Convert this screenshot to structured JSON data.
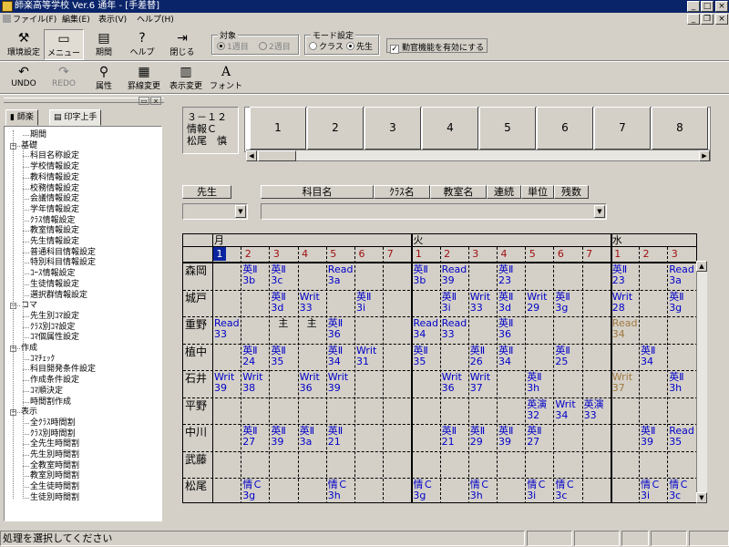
{
  "window": {
    "title": "師楽高等学校 Ver.6 通年 - [手差替]"
  },
  "menu": [
    {
      "label": "ファイル(F)"
    },
    {
      "label": "編集(E)"
    },
    {
      "label": "表示(V)"
    },
    {
      "label": "ヘルプ(H)"
    }
  ],
  "toolbar": {
    "row1": [
      {
        "label": "環境設定",
        "icon": "settings-icon"
      },
      {
        "label": "メニュー",
        "icon": "menu-icon"
      },
      {
        "label": "期間",
        "icon": "period-icon"
      },
      {
        "label": "ヘルプ",
        "icon": "help-icon"
      },
      {
        "label": "閉じる",
        "icon": "close-icon"
      }
    ],
    "row2": [
      {
        "label": "UNDO",
        "icon": "undo-icon"
      },
      {
        "label": "REDO",
        "icon": "redo-icon"
      },
      {
        "label": "属性",
        "icon": "attribute-icon"
      },
      {
        "label": "罫線変更",
        "icon": "grid-lines-icon"
      },
      {
        "label": "表示変更",
        "icon": "display-change-icon"
      },
      {
        "label": "フォント",
        "icon": "font-icon"
      }
    ]
  },
  "target_group": {
    "label": "対象",
    "options": [
      "1週目",
      "2週目"
    ]
  },
  "mode_group": {
    "label": "モード設定",
    "options": [
      "クラス",
      "先生"
    ]
  },
  "check_prohibit": {
    "label": "勤官機能を有効にする"
  },
  "tabs": [
    "師楽",
    "印字上手"
  ],
  "tree": [
    {
      "label": "期間",
      "level": 1
    },
    {
      "label": "基礎",
      "level": 0
    },
    {
      "label": "科目名称設定",
      "level": 1
    },
    {
      "label": "学校情報設定",
      "level": 1
    },
    {
      "label": "教科情報設定",
      "level": 1
    },
    {
      "label": "校務情報設定",
      "level": 1
    },
    {
      "label": "会議情報設定",
      "level": 1
    },
    {
      "label": "学年情報設定",
      "level": 1
    },
    {
      "label": "ｸﾗｽ情報設定",
      "level": 1
    },
    {
      "label": "教室情報設定",
      "level": 1
    },
    {
      "label": "先生情報設定",
      "level": 1
    },
    {
      "label": "普通科目情報設定",
      "level": 1
    },
    {
      "label": "特別科目情報設定",
      "level": 1
    },
    {
      "label": "ｺｰｽ情報設定",
      "level": 1
    },
    {
      "label": "生徒情報設定",
      "level": 1
    },
    {
      "label": "選択群情報設定",
      "level": 1
    },
    {
      "label": "コマ",
      "level": 0
    },
    {
      "label": "先生別ｺﾏ設定",
      "level": 1
    },
    {
      "label": "ｸﾗｽ別ｺﾏ設定",
      "level": 1
    },
    {
      "label": "ｺﾏ個属性設定",
      "level": 1
    },
    {
      "label": "作成",
      "level": 0
    },
    {
      "label": "ｺﾏﾁｪｯｸ",
      "level": 1
    },
    {
      "label": "科目開発条件設定",
      "level": 1
    },
    {
      "label": "作成条件設定",
      "level": 1
    },
    {
      "label": "ｺﾏ順決定",
      "level": 1
    },
    {
      "label": "時間割作成",
      "level": 1
    },
    {
      "label": "表示",
      "level": 0
    },
    {
      "label": "全ｸﾗｽ時間割",
      "level": 1
    },
    {
      "label": "ｸﾗｽ別時間割",
      "level": 1
    },
    {
      "label": "全先生時間割",
      "level": 1
    },
    {
      "label": "先生別時間割",
      "level": 1
    },
    {
      "label": "全教室時間割",
      "level": 1
    },
    {
      "label": "教室別時間割",
      "level": 1
    },
    {
      "label": "全生徒時間割",
      "level": 1
    },
    {
      "label": "生徒別時間割",
      "level": 1
    }
  ],
  "info": {
    "line1": "３－１２",
    "line2": "情報Ｃ",
    "line3": "松尾　慎"
  },
  "period_buttons": [
    "1",
    "2",
    "3",
    "4",
    "5",
    "6",
    "7",
    "8"
  ],
  "columns": [
    "先生",
    "科目名",
    "ｸﾗｽ名",
    "教室名",
    "連続",
    "単位",
    "残数"
  ],
  "grid": {
    "days": [
      "月",
      "火",
      "水"
    ],
    "periods": [
      "1",
      "2",
      "3",
      "4",
      "5",
      "6",
      "7",
      "1",
      "2",
      "3",
      "4",
      "5",
      "6",
      "7",
      "1",
      "2",
      "3"
    ],
    "teachers": [
      "森岡",
      "城戸",
      "重野",
      "植中",
      "石井",
      "平野",
      "中川",
      "武藤",
      "松尾"
    ]
  },
  "cells": [
    {
      "r": 0,
      "c": 1,
      "a": "英Ⅱ",
      "b": "3b"
    },
    {
      "r": 0,
      "c": 2,
      "a": "英Ⅱ",
      "b": "3c"
    },
    {
      "r": 0,
      "c": 4,
      "a": "Read",
      "b": "3a"
    },
    {
      "r": 0,
      "c": 7,
      "a": "英Ⅱ",
      "b": "3b"
    },
    {
      "r": 0,
      "c": 8,
      "a": "Read",
      "b": "39"
    },
    {
      "r": 0,
      "c": 10,
      "a": "英Ⅱ",
      "b": "23"
    },
    {
      "r": 0,
      "c": 14,
      "a": "英Ⅱ",
      "b": "23"
    },
    {
      "r": 0,
      "c": 16,
      "a": "Read",
      "b": "3a"
    },
    {
      "r": 1,
      "c": 2,
      "a": "英Ⅱ",
      "b": "3d"
    },
    {
      "r": 1,
      "c": 3,
      "a": "Writ",
      "b": "33"
    },
    {
      "r": 1,
      "c": 5,
      "a": "英Ⅱ",
      "b": "3i"
    },
    {
      "r": 1,
      "c": 8,
      "a": "英Ⅱ",
      "b": "3i"
    },
    {
      "r": 1,
      "c": 9,
      "a": "Writ",
      "b": "33"
    },
    {
      "r": 1,
      "c": 10,
      "a": "英Ⅱ",
      "b": "3d"
    },
    {
      "r": 1,
      "c": 11,
      "a": "Writ",
      "b": "29"
    },
    {
      "r": 1,
      "c": 12,
      "a": "英Ⅱ",
      "b": "3g"
    },
    {
      "r": 1,
      "c": 14,
      "a": "Writ",
      "b": "28"
    },
    {
      "r": 1,
      "c": 16,
      "a": "英Ⅱ",
      "b": "3g"
    },
    {
      "r": 2,
      "c": 0,
      "a": "Read",
      "b": "33"
    },
    {
      "r": 2,
      "c": 2,
      "a": "",
      "b": "主",
      "k": "blk"
    },
    {
      "r": 2,
      "c": 3,
      "a": "",
      "b": "主",
      "k": "blk"
    },
    {
      "r": 2,
      "c": 4,
      "a": "英Ⅱ",
      "b": "36"
    },
    {
      "r": 2,
      "c": 7,
      "a": "Read",
      "b": "34"
    },
    {
      "r": 2,
      "c": 8,
      "a": "Read",
      "b": "33"
    },
    {
      "r": 2,
      "c": 10,
      "a": "英Ⅱ",
      "b": "36"
    },
    {
      "r": 2,
      "c": 14,
      "a": "Read",
      "b": "34",
      "k": "brown"
    },
    {
      "r": 3,
      "c": 1,
      "a": "英Ⅱ",
      "b": "24"
    },
    {
      "r": 3,
      "c": 2,
      "a": "英Ⅱ",
      "b": "35"
    },
    {
      "r": 3,
      "c": 4,
      "a": "英Ⅱ",
      "b": "34"
    },
    {
      "r": 3,
      "c": 5,
      "a": "Writ",
      "b": "31"
    },
    {
      "r": 3,
      "c": 7,
      "a": "英Ⅱ",
      "b": "35"
    },
    {
      "r": 3,
      "c": 9,
      "a": "英Ⅱ",
      "b": "26"
    },
    {
      "r": 3,
      "c": 10,
      "a": "英Ⅱ",
      "b": "34"
    },
    {
      "r": 3,
      "c": 12,
      "a": "英Ⅱ",
      "b": "25"
    },
    {
      "r": 3,
      "c": 15,
      "a": "英Ⅱ",
      "b": "34"
    },
    {
      "r": 4,
      "c": 0,
      "a": "Writ",
      "b": "39"
    },
    {
      "r": 4,
      "c": 1,
      "a": "Writ",
      "b": "38"
    },
    {
      "r": 4,
      "c": 3,
      "a": "Writ",
      "b": "36"
    },
    {
      "r": 4,
      "c": 4,
      "a": "Writ",
      "b": "39"
    },
    {
      "r": 4,
      "c": 8,
      "a": "Writ",
      "b": "36"
    },
    {
      "r": 4,
      "c": 9,
      "a": "Writ",
      "b": "37"
    },
    {
      "r": 4,
      "c": 11,
      "a": "英Ⅱ",
      "b": "3h"
    },
    {
      "r": 4,
      "c": 14,
      "a": "Writ",
      "b": "37",
      "k": "brown"
    },
    {
      "r": 4,
      "c": 16,
      "a": "英Ⅱ",
      "b": "3h"
    },
    {
      "r": 5,
      "c": 11,
      "a": "英演",
      "b": "32"
    },
    {
      "r": 5,
      "c": 12,
      "a": "Writ",
      "b": "34"
    },
    {
      "r": 5,
      "c": 13,
      "a": "英演",
      "b": "33"
    },
    {
      "r": 6,
      "c": 1,
      "a": "英Ⅱ",
      "b": "27"
    },
    {
      "r": 6,
      "c": 2,
      "a": "英Ⅱ",
      "b": "39"
    },
    {
      "r": 6,
      "c": 3,
      "a": "英Ⅱ",
      "b": "3a"
    },
    {
      "r": 6,
      "c": 4,
      "a": "英Ⅱ",
      "b": "21"
    },
    {
      "r": 6,
      "c": 8,
      "a": "英Ⅱ",
      "b": "21"
    },
    {
      "r": 6,
      "c": 9,
      "a": "英Ⅱ",
      "b": "29"
    },
    {
      "r": 6,
      "c": 10,
      "a": "英Ⅱ",
      "b": "39"
    },
    {
      "r": 6,
      "c": 11,
      "a": "英Ⅱ",
      "b": "27"
    },
    {
      "r": 6,
      "c": 15,
      "a": "英Ⅱ",
      "b": "39"
    },
    {
      "r": 6,
      "c": 16,
      "a": "Read",
      "b": "35"
    },
    {
      "r": 8,
      "c": 1,
      "a": "情Ｃ",
      "b": "3g"
    },
    {
      "r": 8,
      "c": 4,
      "a": "情Ｃ",
      "b": "3h"
    },
    {
      "r": 8,
      "c": 7,
      "a": "情Ｃ",
      "b": "3g"
    },
    {
      "r": 8,
      "c": 9,
      "a": "情Ｃ",
      "b": "3h"
    },
    {
      "r": 8,
      "c": 11,
      "a": "情Ｃ",
      "b": "3i"
    },
    {
      "r": 8,
      "c": 12,
      "a": "情Ｃ",
      "b": "3c"
    },
    {
      "r": 8,
      "c": 15,
      "a": "情Ｃ",
      "b": "3i"
    },
    {
      "r": 8,
      "c": 16,
      "a": "情Ｃ",
      "b": "3c"
    }
  ],
  "status": {
    "message": "処理を選択してください"
  }
}
